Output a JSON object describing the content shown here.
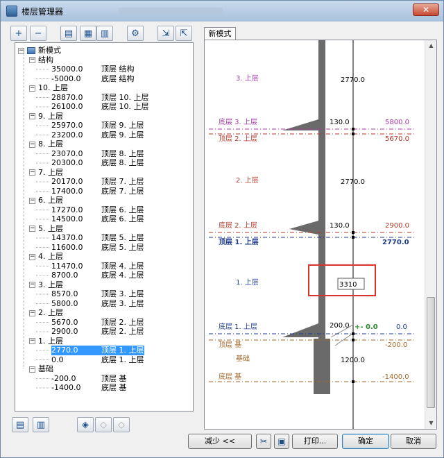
{
  "window": {
    "title": "楼层管理器",
    "close": "✕"
  },
  "toolbar": {
    "buttons": [
      {
        "name": "add-story-button",
        "glyph": "+"
      },
      {
        "name": "remove-story-button",
        "glyph": "−"
      },
      {
        "name": "story-settings-button",
        "glyph": "▤"
      },
      {
        "name": "add-structure-button",
        "glyph": "▦"
      },
      {
        "name": "delete-structure-button",
        "glyph": "▥"
      },
      {
        "name": "properties-button",
        "glyph": "⚙"
      },
      {
        "name": "import-button",
        "glyph": "⇲"
      },
      {
        "name": "export-button",
        "glyph": "⇱"
      }
    ]
  },
  "tree": {
    "root": "新模式",
    "rows": [
      {
        "type": "group",
        "label": "结构"
      },
      {
        "type": "level",
        "value": "35000.0",
        "name": "顶层 结构"
      },
      {
        "type": "level",
        "value": "-5000.0",
        "name": "底层 结构"
      },
      {
        "type": "group",
        "label": "10. 上层"
      },
      {
        "type": "level",
        "value": "28870.0",
        "name": "顶层 10. 上层"
      },
      {
        "type": "level",
        "value": "26100.0",
        "name": "底层 10. 上层"
      },
      {
        "type": "group",
        "label": "9. 上层"
      },
      {
        "type": "level",
        "value": "25970.0",
        "name": "顶层 9. 上层"
      },
      {
        "type": "level",
        "value": "23200.0",
        "name": "底层 9. 上层"
      },
      {
        "type": "group",
        "label": "8. 上层"
      },
      {
        "type": "level",
        "value": "23070.0",
        "name": "顶层 8. 上层"
      },
      {
        "type": "level",
        "value": "20300.0",
        "name": "底层 8. 上层"
      },
      {
        "type": "group",
        "label": "7. 上层"
      },
      {
        "type": "level",
        "value": "20170.0",
        "name": "顶层 7. 上层"
      },
      {
        "type": "level",
        "value": "17400.0",
        "name": "底层 7. 上层"
      },
      {
        "type": "group",
        "label": "6. 上层"
      },
      {
        "type": "level",
        "value": "17270.0",
        "name": "顶层 6. 上层"
      },
      {
        "type": "level",
        "value": "14500.0",
        "name": "底层 6. 上层"
      },
      {
        "type": "group",
        "label": "5. 上层"
      },
      {
        "type": "level",
        "value": "14370.0",
        "name": "顶层 5. 上层"
      },
      {
        "type": "level",
        "value": "11600.0",
        "name": "底层 5. 上层"
      },
      {
        "type": "group",
        "label": "4. 上层"
      },
      {
        "type": "level",
        "value": "11470.0",
        "name": "顶层 4. 上层"
      },
      {
        "type": "level",
        "value": "8700.0",
        "name": "底层 4. 上层"
      },
      {
        "type": "group",
        "label": "3. 上层"
      },
      {
        "type": "level",
        "value": "8570.0",
        "name": "顶层 3. 上层"
      },
      {
        "type": "level",
        "value": "5800.0",
        "name": "底层 3. 上层"
      },
      {
        "type": "group",
        "label": "2. 上层"
      },
      {
        "type": "level",
        "value": "5670.0",
        "name": "顶层 2. 上层"
      },
      {
        "type": "level",
        "value": "2900.0",
        "name": "底层 2. 上层"
      },
      {
        "type": "group",
        "label": "1. 上层"
      },
      {
        "type": "level",
        "value": "2770.0",
        "name": "顶层 1. 上层",
        "selected": true
      },
      {
        "type": "level",
        "value": "0.0",
        "name": "底层 1. 上层"
      },
      {
        "type": "group",
        "label": "基础"
      },
      {
        "type": "level",
        "value": "-200.0",
        "name": "顶层 基"
      },
      {
        "type": "level",
        "value": "-1400.0",
        "name": "底层 基"
      }
    ]
  },
  "tab": {
    "label": "新模式"
  },
  "section": {
    "story_labels": {
      "s3": "3. 上层",
      "s2": "2. 上层",
      "s1": "1. 上层",
      "base": "基础"
    },
    "level_labels": {
      "bottom3": "底层 3. 上层",
      "top2": "顶层 2. 上层",
      "bottom2": "底层 2. 上层",
      "top1": "顶层 1. 上层",
      "bottom1": "底层 1. 上层",
      "topbase": "顶层 基",
      "bottombase": "底层 基"
    },
    "dims": {
      "h3": "2770.0",
      "slab3": "130.0",
      "h2": "2770.0",
      "slab2": "130.0",
      "h1": "3310",
      "slab1": "200.0",
      "hbase": "1200.0"
    },
    "elevations": {
      "bottom3": "5800.0",
      "top2": "5670.0",
      "bottom2": "2900.0",
      "top1": "2770.0",
      "bottom1": "0.0",
      "topbase": "-200.0",
      "bottombase": "-1400.0",
      "zero": "+- 0.0"
    },
    "colors": {
      "story3": "#a83aa8",
      "story2": "#b23a2b",
      "story1": "#1f3c8f",
      "base": "#a66a2a",
      "highlight": "#d9342b"
    }
  },
  "footer": {
    "collapse": "减少 <<",
    "print": "打印...",
    "ok": "确定",
    "cancel": "取消"
  }
}
